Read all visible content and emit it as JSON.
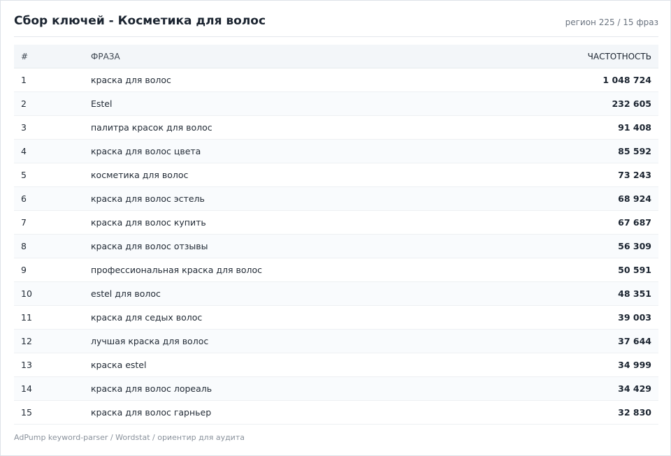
{
  "header": {
    "title": "Сбор ключей - Косметика для волос",
    "meta": "регион 225 / 15 фраз"
  },
  "table": {
    "columns": [
      "#",
      "ФРАЗА",
      "ЧАСТОТНОСТЬ"
    ],
    "rows": [
      {
        "idx": "1",
        "phrase": "краска для волос",
        "freq": "1 048 724"
      },
      {
        "idx": "2",
        "phrase": "Estel",
        "freq": "232 605"
      },
      {
        "idx": "3",
        "phrase": "палитра красок для волос",
        "freq": "91 408"
      },
      {
        "idx": "4",
        "phrase": "краска для волос цвета",
        "freq": "85 592"
      },
      {
        "idx": "5",
        "phrase": "косметика для волос",
        "freq": "73 243"
      },
      {
        "idx": "6",
        "phrase": "краска для волос эстель",
        "freq": "68 924"
      },
      {
        "idx": "7",
        "phrase": "краска для волос купить",
        "freq": "67 687"
      },
      {
        "idx": "8",
        "phrase": "краска для волос отзывы",
        "freq": "56 309"
      },
      {
        "idx": "9",
        "phrase": "профессиональная краска для волос",
        "freq": "50 591"
      },
      {
        "idx": "10",
        "phrase": "estel для волос",
        "freq": "48 351"
      },
      {
        "idx": "11",
        "phrase": "краска для седых волос",
        "freq": "39 003"
      },
      {
        "idx": "12",
        "phrase": "лучшая краска для волос",
        "freq": "37 644"
      },
      {
        "idx": "13",
        "phrase": "краска estel",
        "freq": "34 999"
      },
      {
        "idx": "14",
        "phrase": "краска для волос лореаль",
        "freq": "34 429"
      },
      {
        "idx": "15",
        "phrase": "краска для волос гарньер",
        "freq": "32 830"
      }
    ]
  },
  "footer": {
    "text": "AdPump keyword-parser / Wordstat / ориентир для аудита"
  }
}
